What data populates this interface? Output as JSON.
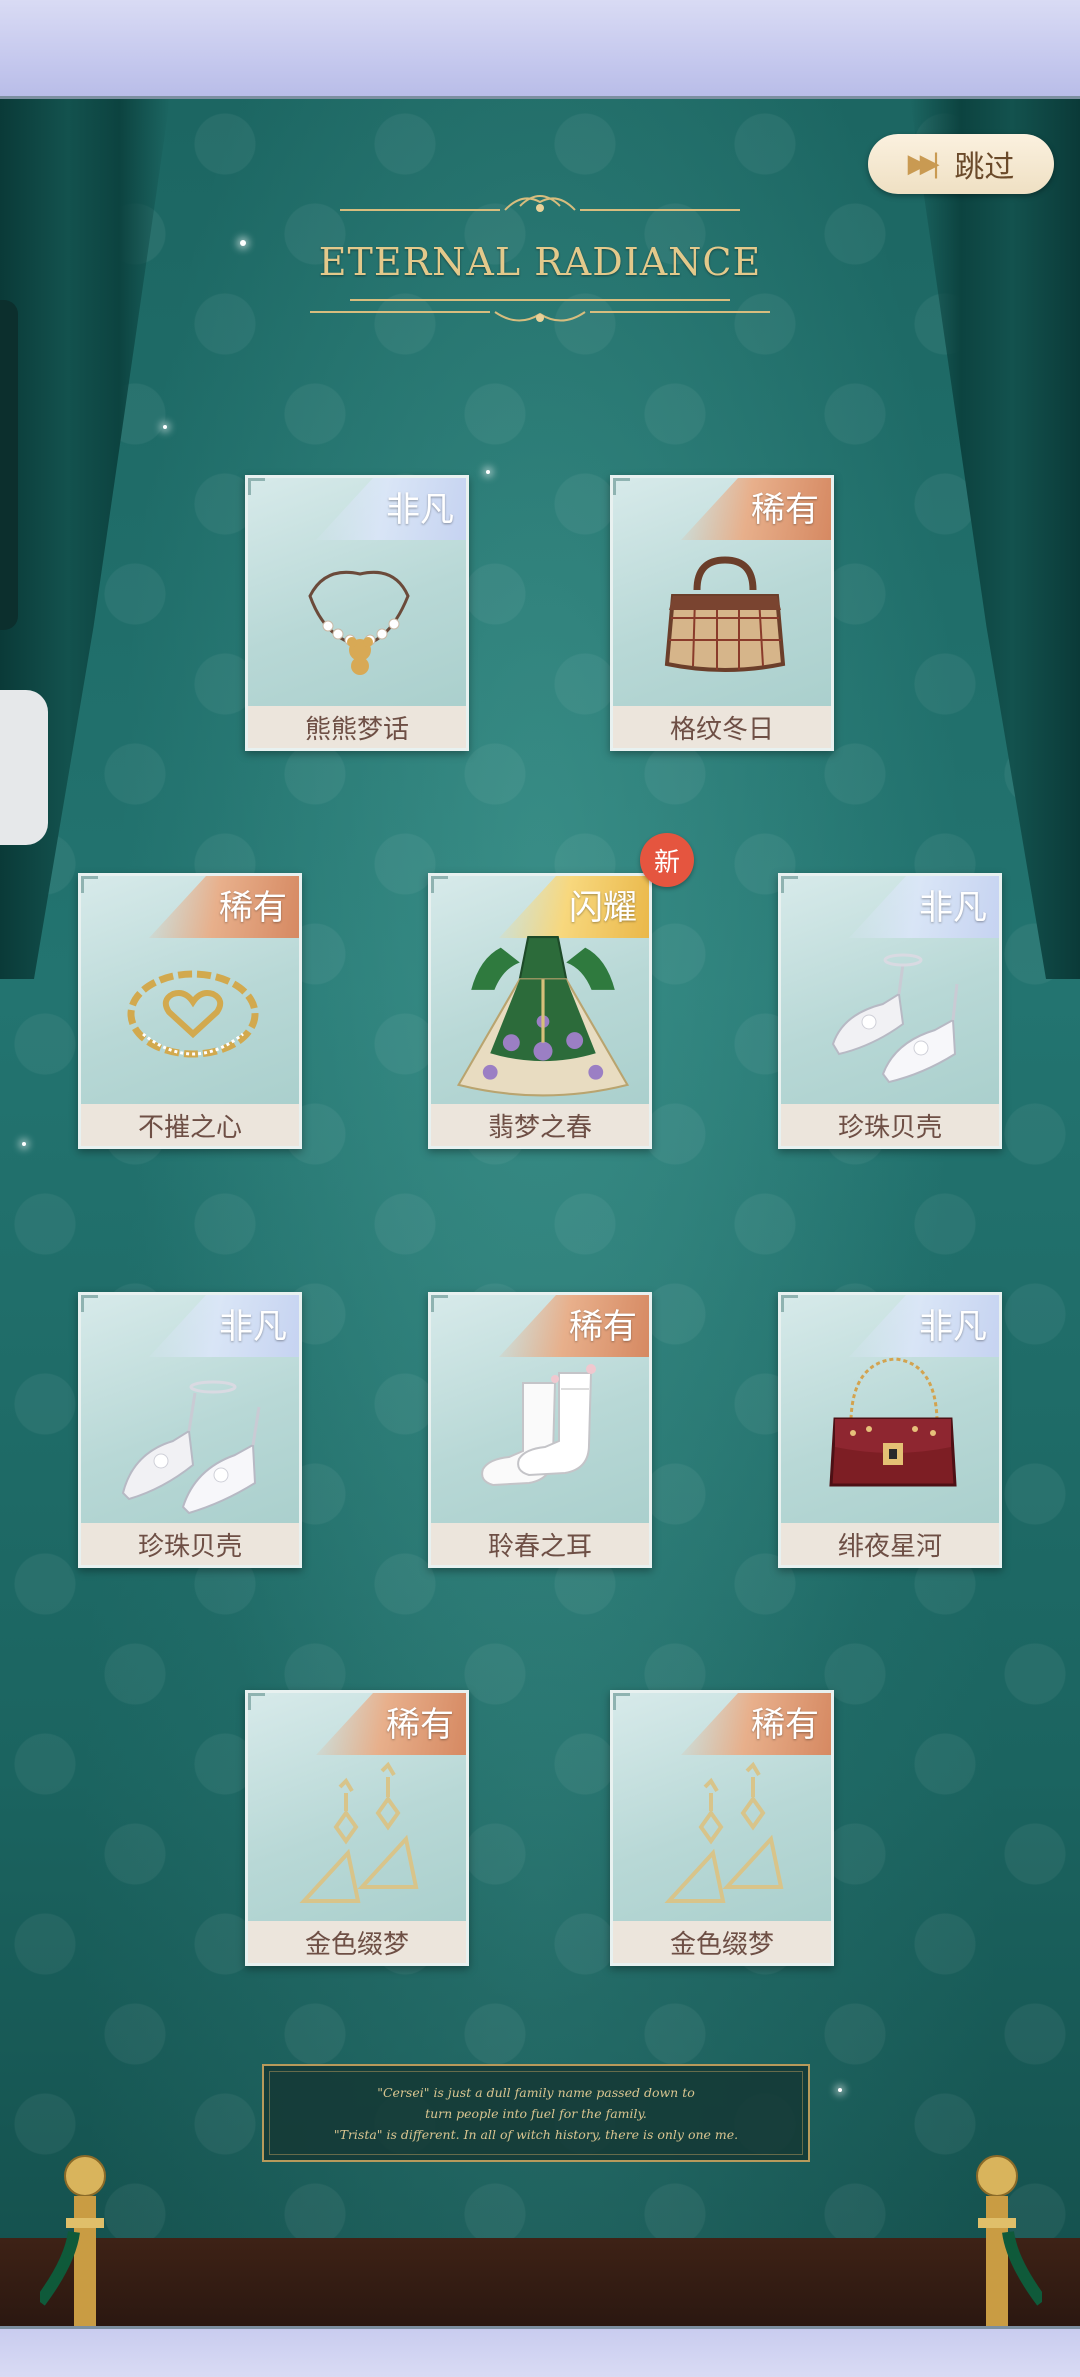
{
  "top_bar": {},
  "skip_button": {
    "label": "跳过",
    "icon": "fast-forward-icon"
  },
  "title": "ETERNAL RADIANCE",
  "items": [
    {
      "name": "熊熊梦话",
      "rarity": "非凡",
      "icon": "necklace-icon",
      "is_new": false
    },
    {
      "name": "格纹冬日",
      "rarity": "稀有",
      "icon": "handbag-icon",
      "is_new": false
    },
    {
      "name": "不摧之心",
      "rarity": "稀有",
      "icon": "heart-bracelet-icon",
      "is_new": false
    },
    {
      "name": "翡梦之春",
      "rarity": "闪耀",
      "icon": "dress-icon",
      "is_new": true
    },
    {
      "name": "珍珠贝壳",
      "rarity": "非凡",
      "icon": "heels-icon",
      "is_new": false
    },
    {
      "name": "珍珠贝壳",
      "rarity": "非凡",
      "icon": "heels-icon",
      "is_new": false
    },
    {
      "name": "聆春之耳",
      "rarity": "稀有",
      "icon": "socks-icon",
      "is_new": false
    },
    {
      "name": "绯夜星河",
      "rarity": "非凡",
      "icon": "purse-icon",
      "is_new": false
    },
    {
      "name": "金色缀梦",
      "rarity": "稀有",
      "icon": "earrings-icon",
      "is_new": false
    },
    {
      "name": "金色缀梦",
      "rarity": "稀有",
      "icon": "earrings-icon",
      "is_new": false
    }
  ],
  "new_badge": "新",
  "quote": {
    "line1": "\"Cersei\" is just a dull family name passed down to",
    "line2": "turn people into fuel for the family.",
    "line3": "\"Trista\" is different. In all of witch history, there is only one me."
  },
  "colors": {
    "background": "#1f6e6a",
    "card": "#b8d8d6",
    "name_bar": "#ece5dc",
    "rare_ribbon": "#d68962",
    "extraordinary_ribbon": "#c6d3f1",
    "shining_ribbon": "#eab84a",
    "new_badge": "#e5553f",
    "gold": "#e3c98b"
  }
}
